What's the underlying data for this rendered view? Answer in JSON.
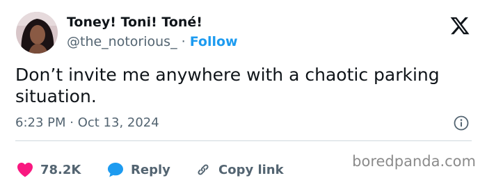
{
  "tweet": {
    "author_name": "Toney! Toni! Toné!",
    "author_handle": "@the_notorious_",
    "separator": "·",
    "follow_label": "Follow",
    "text": "Don’t invite me anywhere with a chaotic parking situation.",
    "timestamp": "6:23 PM · Oct 13, 2024"
  },
  "actions": {
    "like_count": "78.2K",
    "reply_label": "Reply",
    "copy_link_label": "Copy link"
  },
  "watermark": "boredpanda.com",
  "colors": {
    "accent": "#1d9bf0",
    "like": "#f91880",
    "text": "#0f1419",
    "secondary": "#536471"
  },
  "icons": {
    "avatar": "profile-photo",
    "platform": "x-logo-icon",
    "info": "info-icon",
    "like": "heart-icon",
    "reply": "speech-bubble-icon",
    "copy_link": "link-icon"
  }
}
